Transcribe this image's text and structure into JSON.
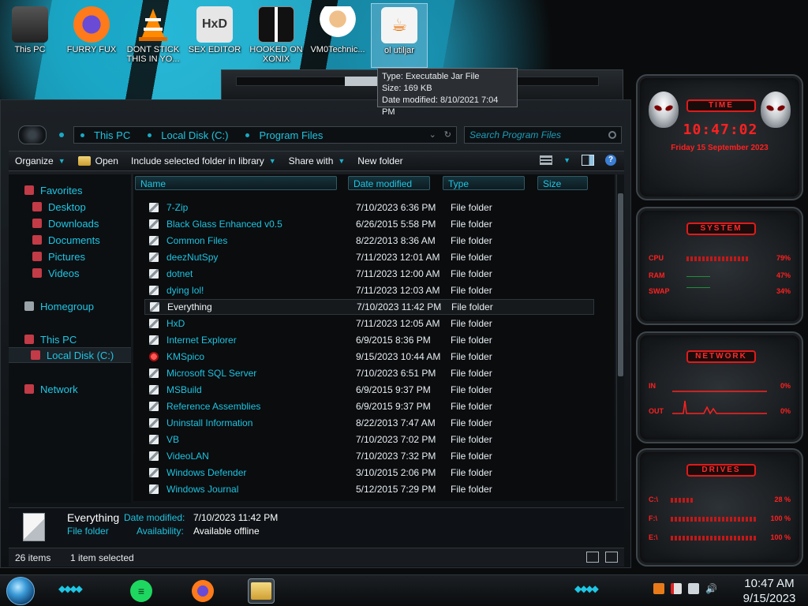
{
  "desktop": {
    "icons": [
      {
        "label": "This PC"
      },
      {
        "label": "FURRY FUX"
      },
      {
        "label": "DONT STICK THIS IN YO..."
      },
      {
        "label": "SEX EDITOR"
      },
      {
        "label": "HOOKED ON XONIX"
      },
      {
        "label": "VM0Technic..."
      },
      {
        "label": "ol utiljar"
      }
    ],
    "tooltip": {
      "type": "Type: Executable Jar File",
      "size": "Size: 169 KB",
      "modified": "Date modified: 8/10/2021 7:04 PM"
    }
  },
  "explorer": {
    "address": [
      "This PC",
      "Local Disk (C:)",
      "Program Files"
    ],
    "search_placeholder": "Search Program Files",
    "toolbar": {
      "organize": "Organize",
      "open": "Open",
      "include": "Include selected folder in library",
      "share": "Share with",
      "new_folder": "New folder"
    },
    "nav": {
      "favorites": "Favorites",
      "desktop": "Desktop",
      "downloads": "Downloads",
      "documents": "Documents",
      "pictures": "Pictures",
      "videos": "Videos",
      "homegroup": "Homegroup",
      "thispc": "This PC",
      "localdisk": "Local Disk (C:)",
      "network": "Network"
    },
    "columns": {
      "name": "Name",
      "date": "Date modified",
      "type": "Type",
      "size": "Size"
    },
    "files": [
      {
        "name": "7-Zip",
        "date": "7/10/2023 6:36 PM",
        "type": "File folder"
      },
      {
        "name": "Black Glass Enhanced v0.5",
        "date": "6/26/2015 5:58 PM",
        "type": "File folder"
      },
      {
        "name": "Common Files",
        "date": "8/22/2013 8:36 AM",
        "type": "File folder"
      },
      {
        "name": "deezNutSpy",
        "date": "7/11/2023 12:01 AM",
        "type": "File folder"
      },
      {
        "name": "dotnet",
        "date": "7/11/2023 12:00 AM",
        "type": "File folder"
      },
      {
        "name": "dying lol!",
        "date": "7/11/2023 12:03 AM",
        "type": "File folder"
      },
      {
        "name": "Everything",
        "date": "7/10/2023 11:42 PM",
        "type": "File folder"
      },
      {
        "name": "HxD",
        "date": "7/11/2023 12:05 AM",
        "type": "File folder"
      },
      {
        "name": "Internet Explorer",
        "date": "6/9/2015 8:36 PM",
        "type": "File folder"
      },
      {
        "name": "KMSpico",
        "date": "9/15/2023 10:44 AM",
        "type": "File folder"
      },
      {
        "name": "Microsoft SQL Server",
        "date": "7/10/2023 6:51 PM",
        "type": "File folder"
      },
      {
        "name": "MSBuild",
        "date": "6/9/2015 9:37 PM",
        "type": "File folder"
      },
      {
        "name": "Reference Assemblies",
        "date": "6/9/2015 9:37 PM",
        "type": "File folder"
      },
      {
        "name": "Uninstall Information",
        "date": "8/22/2013 7:47 AM",
        "type": "File folder"
      },
      {
        "name": "VB",
        "date": "7/10/2023 7:02 PM",
        "type": "File folder"
      },
      {
        "name": "VideoLAN",
        "date": "7/10/2023 7:32 PM",
        "type": "File folder"
      },
      {
        "name": "Windows Defender",
        "date": "3/10/2015 2:06 PM",
        "type": "File folder"
      },
      {
        "name": "Windows Journal",
        "date": "5/12/2015 7:29 PM",
        "type": "File folder"
      }
    ],
    "details": {
      "name": "Everything",
      "type": "File folder",
      "date_label": "Date modified:",
      "date_value": "7/10/2023 11:42 PM",
      "avail_label": "Availability:",
      "avail_value": "Available offline"
    },
    "status": {
      "count": "26 items",
      "selected": "1 item selected"
    }
  },
  "gadgets": {
    "time_title": "TIME",
    "time": "10:47:02",
    "date": "Friday 15 September 2023",
    "system_title": "SYSTEM",
    "cpu_label": "CPU",
    "cpu_value": "79%",
    "ram_label": "RAM",
    "ram_value": "47%",
    "swap_label": "SWAP",
    "swap_value": "34%",
    "network_title": "NETWORK",
    "in_label": "IN",
    "in_value": "0%",
    "out_label": "OUT",
    "out_value": "0%",
    "drives_title": "DRIVES",
    "d1_label": "C:\\",
    "d1_value": "28 %",
    "d2_label": "F:\\",
    "d2_value": "100 %",
    "d3_label": "E:\\",
    "d3_value": "100 %"
  },
  "taskbar": {
    "time": "10:47 AM",
    "date": "9/15/2023"
  },
  "colors": {
    "accent": "#1ec6e4",
    "gadget_red": "#ff2020"
  }
}
